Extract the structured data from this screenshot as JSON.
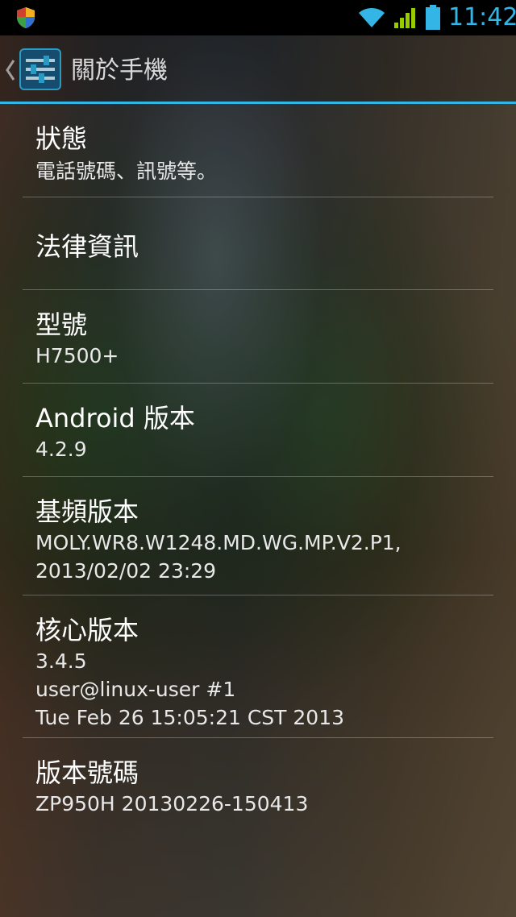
{
  "status_bar": {
    "time": "11:42",
    "icons": [
      "shield-icon",
      "wifi-icon",
      "signal-icon",
      "battery-icon"
    ]
  },
  "action_bar": {
    "title": "關於手機",
    "icon": "settings-icon",
    "accent_color": "#33b5e5"
  },
  "items": [
    {
      "title": "狀態",
      "summary": "電話號碼、訊號等。"
    },
    {
      "title": "法律資訊",
      "summary": ""
    },
    {
      "title": "型號",
      "summary": "H7500+"
    },
    {
      "title": "Android 版本",
      "summary": "4.2.9"
    },
    {
      "title": "基頻版本",
      "summary": "MOLY.WR8.W1248.MD.WG.MP.V2.P1,\n2013/02/02 23:29"
    },
    {
      "title": "核心版本",
      "summary": "3.4.5\nuser@linux-user #1\nTue Feb 26 15:05:21 CST 2013"
    },
    {
      "title": "版本號碼",
      "summary": "ZP950H 20130226-150413"
    }
  ]
}
